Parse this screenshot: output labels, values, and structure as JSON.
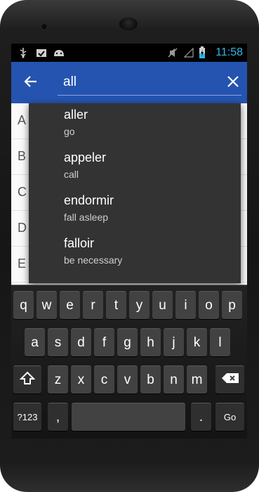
{
  "status_bar": {
    "icons_left": [
      "usb-icon",
      "clipboard-check-icon",
      "android-icon"
    ],
    "icons_right": [
      "mute-icon",
      "no-signal-icon",
      "battery-charging-icon"
    ],
    "time": "11:58",
    "time_color": "#33b5e5"
  },
  "appbar": {
    "color": "#2554b0",
    "search_value": "all"
  },
  "background_list": {
    "letters": [
      "A",
      "B",
      "C",
      "D",
      "E"
    ]
  },
  "suggestions": [
    {
      "word": "aller",
      "translation": "go"
    },
    {
      "word": "appeler",
      "translation": "call"
    },
    {
      "word": "endormir",
      "translation": "fall asleep"
    },
    {
      "word": "falloir",
      "translation": "be necessary"
    }
  ],
  "keyboard": {
    "row1": [
      "q",
      "w",
      "e",
      "r",
      "t",
      "y",
      "u",
      "i",
      "o",
      "p"
    ],
    "row2": [
      "a",
      "s",
      "d",
      "f",
      "g",
      "h",
      "j",
      "k",
      "l"
    ],
    "row3": [
      "z",
      "x",
      "c",
      "v",
      "b",
      "n",
      "m"
    ],
    "sym_label": "?123",
    "comma_label": ",",
    "period_label": ".",
    "go_label": "Go"
  }
}
